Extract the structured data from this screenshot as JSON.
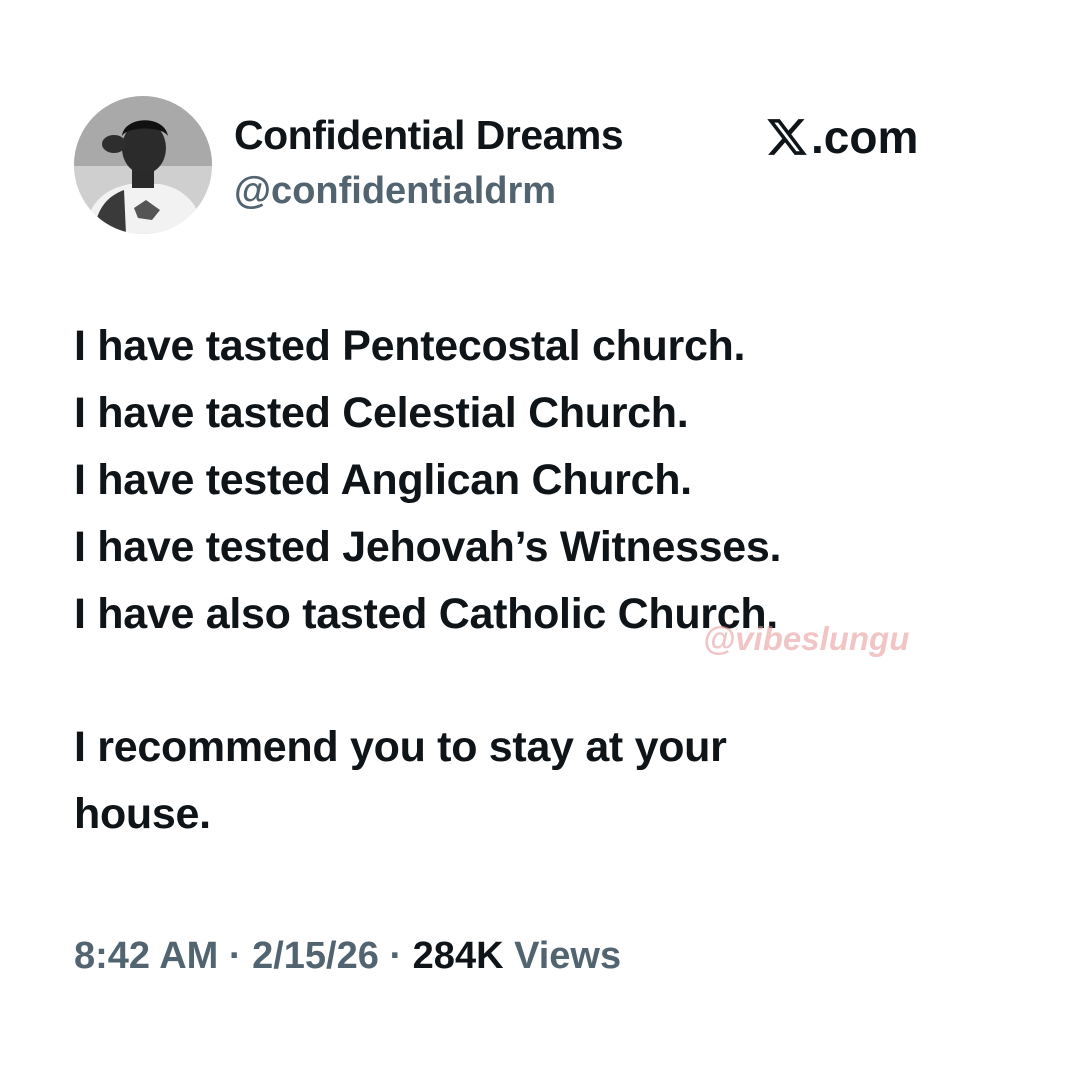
{
  "author": {
    "display_name": "Confidential Dreams",
    "handle": "@confidentialdrm",
    "avatar_icon": "profile-photo"
  },
  "brand": {
    "label": ".com",
    "logo_icon": "x-logo-icon"
  },
  "tweet": {
    "lines": [
      "I have tasted Pentecostal church.",
      "I have tasted Celestial Church.",
      "I have tested Anglican Church.",
      "I have tested Jehovah’s Witnesses.",
      "I have also tasted Catholic Church."
    ],
    "conclusion_lines": [
      "I recommend you to stay at your",
      "house."
    ]
  },
  "watermark": "@vibeslungu",
  "meta": {
    "time": "8:42 AM",
    "separator": "·",
    "date": "2/15/26",
    "views_count": "284K",
    "views_label": "Views"
  },
  "colors": {
    "text_primary": "#0f1419",
    "text_secondary": "#536471",
    "background": "#ffffff"
  }
}
